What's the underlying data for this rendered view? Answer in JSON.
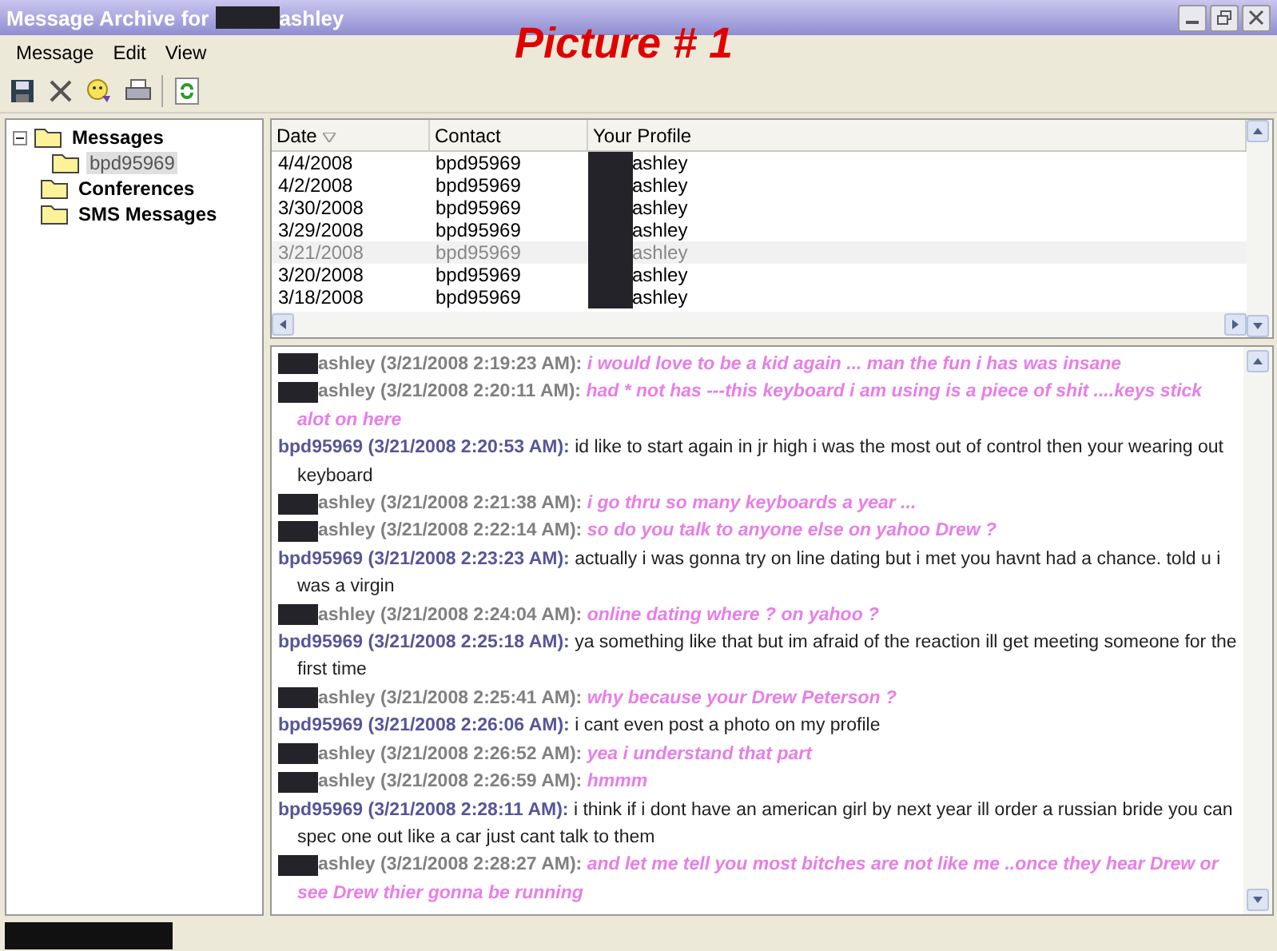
{
  "window": {
    "title_prefix": "Message Archive for",
    "title_suffix": "ashley"
  },
  "annotation": "Picture # 1",
  "menu": [
    "Message",
    "Edit",
    "View"
  ],
  "tree": [
    {
      "label": "Messages",
      "expanded": true,
      "selected": false,
      "children": [
        {
          "label": "bpd95969",
          "selected": true
        }
      ]
    },
    {
      "label": "Conferences",
      "selected": false
    },
    {
      "label": "SMS Messages",
      "selected": false
    }
  ],
  "table": {
    "columns": [
      "Date",
      "Contact",
      "Your Profile"
    ],
    "rows": [
      {
        "date": "4/4/2008",
        "contact": "bpd95969",
        "profile": "ashley",
        "selected": false
      },
      {
        "date": "4/2/2008",
        "contact": "bpd95969",
        "profile": "ashley",
        "selected": false
      },
      {
        "date": "3/30/2008",
        "contact": "bpd95969",
        "profile": "ashley",
        "selected": false
      },
      {
        "date": "3/29/2008",
        "contact": "bpd95969",
        "profile": "ashley",
        "selected": false
      },
      {
        "date": "3/21/2008",
        "contact": "bpd95969",
        "profile": "ashley",
        "selected": true
      },
      {
        "date": "3/20/2008",
        "contact": "bpd95969",
        "profile": "ashley",
        "selected": false
      },
      {
        "date": "3/18/2008",
        "contact": "bpd95969",
        "profile": "ashley",
        "selected": false
      }
    ]
  },
  "messages": [
    {
      "kind": "self",
      "header": "ashley (3/21/2008 2:19:23 AM):",
      "text": "i would love to be a kid again ... man the fun i has was insane"
    },
    {
      "kind": "self",
      "header": "ashley (3/21/2008 2:20:11 AM):",
      "text": "had * not has ---this keyboard i am using is a piece of shit ....keys stick alot on here"
    },
    {
      "kind": "contact",
      "header": "bpd95969 (3/21/2008 2:20:53 AM):",
      "text": "id like to start again in jr high i was the most out of control then your wearing out keyboard"
    },
    {
      "kind": "self",
      "header": "ashley (3/21/2008 2:21:38 AM):",
      "text": "i go thru so many keyboards a year ..."
    },
    {
      "kind": "self",
      "header": "ashley (3/21/2008 2:22:14 AM):",
      "text": "so do you talk to anyone else on yahoo Drew ?"
    },
    {
      "kind": "contact",
      "header": "bpd95969 (3/21/2008 2:23:23 AM):",
      "text": "actually i was gonna try on line dating but i met you havnt had a chance. told u i was a virgin"
    },
    {
      "kind": "self",
      "header": "ashley (3/21/2008 2:24:04 AM):",
      "text": "online dating where ? on yahoo ?"
    },
    {
      "kind": "contact",
      "header": "bpd95969 (3/21/2008 2:25:18 AM):",
      "text": "ya something like that but im afraid of the reaction ill get meeting someone for the first time"
    },
    {
      "kind": "self",
      "header": "ashley (3/21/2008 2:25:41 AM):",
      "text": "why because your Drew Peterson ?"
    },
    {
      "kind": "contact",
      "header": "bpd95969 (3/21/2008 2:26:06 AM):",
      "text": "i cant even post a photo on my profile"
    },
    {
      "kind": "self",
      "header": "ashley (3/21/2008 2:26:52 AM):",
      "text": "yea i understand that part"
    },
    {
      "kind": "self",
      "header": "ashley (3/21/2008 2:26:59 AM):",
      "text": "hmmm"
    },
    {
      "kind": "contact",
      "header": "bpd95969 (3/21/2008 2:28:11 AM):",
      "text": "i think if i dont have an american girl by next year ill order a russian bride you can spec one out like a car just cant talk to them"
    },
    {
      "kind": "self",
      "header": "ashley (3/21/2008 2:28:27 AM):",
      "text": "and let me tell you most bitches are not like me ..once they hear Drew or see Drew thier gonna be running"
    }
  ]
}
